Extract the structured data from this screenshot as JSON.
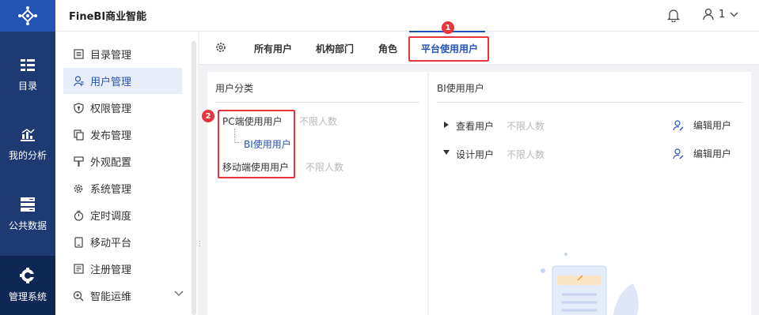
{
  "header": {
    "brand": "FineBI商业智能",
    "user_name": "1"
  },
  "nav": {
    "items": [
      {
        "label": "目录",
        "icon": "catalog-icon"
      },
      {
        "label": "我的分析",
        "icon": "analysis-icon"
      },
      {
        "label": "公共数据",
        "icon": "database-icon"
      },
      {
        "label": "管理系统",
        "icon": "management-gear-icon",
        "active": true
      }
    ]
  },
  "menu": {
    "items": [
      {
        "label": "目录管理",
        "icon": "list-icon"
      },
      {
        "label": "用户管理",
        "icon": "user-icon",
        "active": true
      },
      {
        "label": "权限管理",
        "icon": "shield-icon"
      },
      {
        "label": "发布管理",
        "icon": "copy-icon"
      },
      {
        "label": "外观配置",
        "icon": "brush-icon"
      },
      {
        "label": "系统管理",
        "icon": "settings-icon"
      },
      {
        "label": "定时调度",
        "icon": "timer-icon"
      },
      {
        "label": "移动平台",
        "icon": "mobile-icon"
      },
      {
        "label": "注册管理",
        "icon": "register-icon"
      },
      {
        "label": "智能运维",
        "icon": "ops-icon"
      }
    ]
  },
  "tabs": {
    "items": [
      "所有用户",
      "机构部门",
      "角色",
      "平台使用用户"
    ],
    "active_index": 3
  },
  "badges": {
    "one": "1",
    "two": "2"
  },
  "left_panel": {
    "title": "用户分类",
    "rows": [
      {
        "label": "PC端使用用户",
        "limit": "不限人数"
      },
      {
        "label": "BI使用用户"
      },
      {
        "label": "移动端使用用户",
        "limit": "不限人数"
      }
    ]
  },
  "right_panel": {
    "title": "BI使用用户",
    "rows": [
      {
        "label": "查看用户",
        "limit": "不限人数",
        "action": "编辑用户",
        "expanded": false
      },
      {
        "label": "设计用户",
        "limit": "不限人数",
        "action": "编辑用户",
        "expanded": true
      }
    ]
  },
  "colors": {
    "brand": "#2553b5",
    "nav": "#1d3a73",
    "highlight": "#e8343b"
  }
}
